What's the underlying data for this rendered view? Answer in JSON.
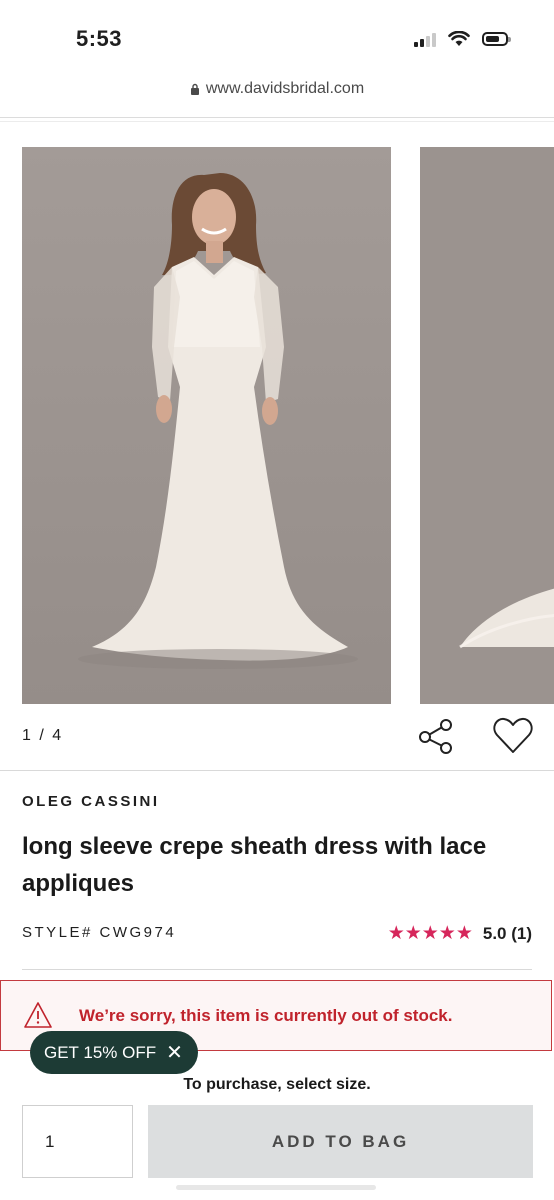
{
  "status_bar": {
    "time": "5:53",
    "icons": [
      "signal-icon",
      "wifi-icon",
      "battery-icon"
    ]
  },
  "browser": {
    "url": "www.davidsbridal.com",
    "icon": "lock-icon"
  },
  "gallery": {
    "pager": "1 / 4"
  },
  "actions": {
    "share_icon": "share-icon",
    "favorite_icon": "heart-icon"
  },
  "product": {
    "brand": "OLEG CASSINI",
    "title": "long sleeve crepe sheath dress with lace appliques",
    "style": "STYLE# CWG974",
    "rating_value": "5.0 (1)",
    "stars": "★★★★★",
    "star_color": "#d6265b"
  },
  "alert": {
    "message": "We’re sorry, this item is currently out of stock.",
    "icon": "warning-icon",
    "color": "#c0232c"
  },
  "promo": {
    "label": "GET 15% OFF",
    "close": "✕"
  },
  "purchase": {
    "note": "To purchase, select size.",
    "quantity": "1",
    "add_to_bag": "ADD TO BAG"
  },
  "colors": {
    "promo_bg": "#1d3b35",
    "button_bg": "#dcdedf"
  }
}
